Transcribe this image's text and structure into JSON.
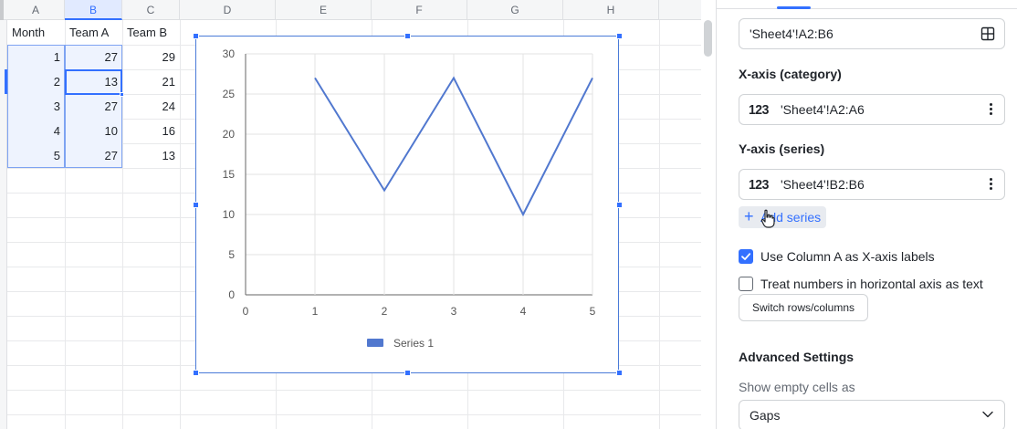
{
  "sheet": {
    "columns": [
      "A",
      "B",
      "C",
      "D",
      "E",
      "F",
      "G",
      "H"
    ],
    "headers": [
      "Month",
      "Team A",
      "Team B"
    ],
    "rows": [
      [
        "1",
        "27",
        "29"
      ],
      [
        "2",
        "13",
        "21"
      ],
      [
        "3",
        "27",
        "24"
      ],
      [
        "4",
        "10",
        "16"
      ],
      [
        "5",
        "27",
        "13"
      ]
    ]
  },
  "chart_data": {
    "type": "line",
    "x": [
      1,
      2,
      3,
      4,
      5
    ],
    "series": [
      {
        "name": "Series 1",
        "values": [
          27,
          13,
          27,
          10,
          27
        ],
        "color": "#5178cf"
      }
    ],
    "xlim": [
      0,
      5
    ],
    "ylim": [
      0,
      30
    ],
    "x_ticks": [
      "0",
      "1",
      "2",
      "3",
      "4",
      "5"
    ],
    "y_ticks": [
      "0",
      "5",
      "10",
      "15",
      "20",
      "25",
      "30"
    ],
    "grid": true,
    "legend_position": "bottom"
  },
  "panel": {
    "data_range": "'Sheet4'!A2:B6",
    "x_axis_label": "X-axis (category)",
    "x_axis_type": "123",
    "x_axis_range": "'Sheet4'!A2:A6",
    "y_axis_label": "Y-axis (series)",
    "y_axis_type": "123",
    "y_axis_range": "'Sheet4'!B2:B6",
    "add_series": "Add series",
    "use_column_a": "Use Column A as X-axis labels",
    "use_column_a_checked": true,
    "treat_numbers": "Treat numbers in horizontal axis as text",
    "treat_numbers_checked": false,
    "switch_rows": "Switch rows/columns",
    "advanced": "Advanced Settings",
    "show_empty_label": "Show empty cells as",
    "show_empty_value": "Gaps",
    "accent_color": "#3370ff"
  }
}
